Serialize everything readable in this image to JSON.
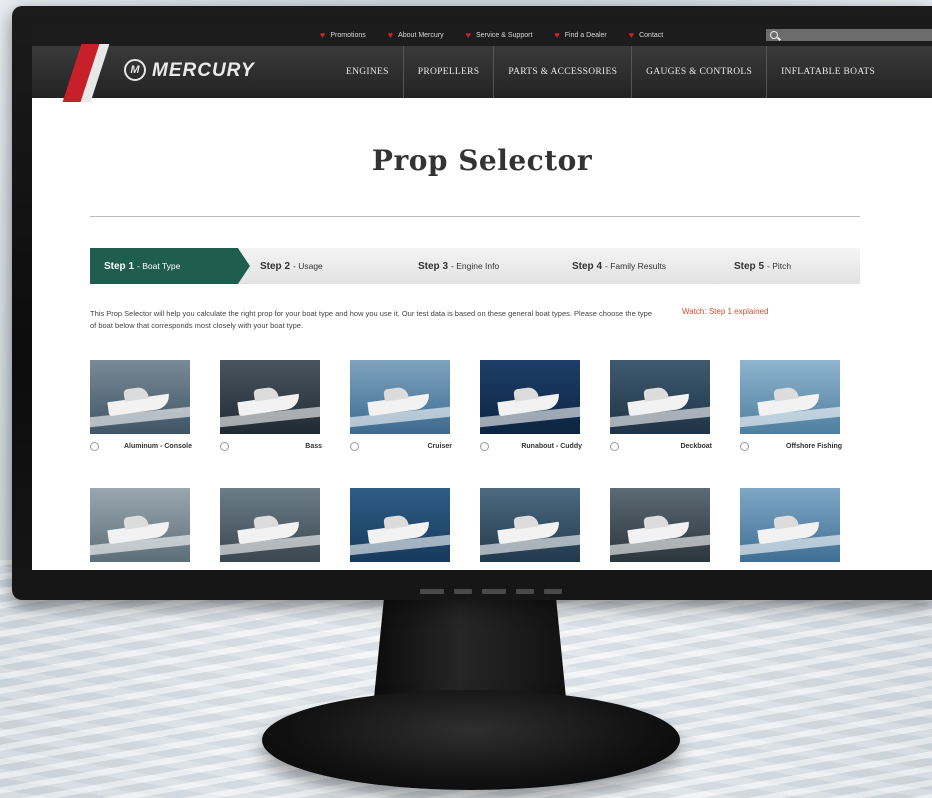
{
  "top_links": [
    {
      "label": "Promotions",
      "icon": "heart-icon"
    },
    {
      "label": "About Mercury",
      "icon": "heart-icon"
    },
    {
      "label": "Service & Support",
      "icon": "heart-icon"
    },
    {
      "label": "Find a Dealer",
      "icon": "heart-icon"
    },
    {
      "label": "Contact",
      "icon": "heart-icon"
    }
  ],
  "search": {
    "placeholder": ""
  },
  "brand": {
    "name": "MERCURY",
    "emblem": "M"
  },
  "nav": [
    "ENGINES",
    "PROPELLERS",
    "PARTS & ACCESSORIES",
    "GAUGES & CONTROLS",
    "INFLATABLE BOATS"
  ],
  "page_title": "Prop Selector",
  "steps": [
    {
      "num": "Step 1",
      "label": "- Boat Type",
      "active": true
    },
    {
      "num": "Step 2",
      "label": "- Usage",
      "active": false
    },
    {
      "num": "Step 3",
      "label": "- Engine Info",
      "active": false
    },
    {
      "num": "Step 4",
      "label": "- Family Results",
      "active": false
    },
    {
      "num": "Step 5",
      "label": "- Pitch",
      "active": false
    }
  ],
  "intro_text": "This Prop Selector will help you calculate the right prop for your boat type and how you use it. Our test data is based on these general boat types. Please choose the type of boat below that corresponds most closely with your boat type.",
  "watch_link": "Watch: Step 1 explained",
  "boats": [
    {
      "label": "Aluminum - Console",
      "colors": [
        "#7a8a96",
        "#3f5566"
      ]
    },
    {
      "label": "Bass",
      "colors": [
        "#4a5560",
        "#1f2a33"
      ]
    },
    {
      "label": "Cruiser",
      "colors": [
        "#7fa3bf",
        "#3c6a8f"
      ]
    },
    {
      "label": "Runabout - Cuddy",
      "colors": [
        "#1d3f6a",
        "#0c2440"
      ]
    },
    {
      "label": "Deckboat",
      "colors": [
        "#3f5a70",
        "#1f3446"
      ]
    },
    {
      "label": "Offshore Fishing",
      "colors": [
        "#8fb4cf",
        "#4f7f9f"
      ]
    },
    {
      "label": "",
      "colors": [
        "#9aa7ae",
        "#5d6e78"
      ]
    },
    {
      "label": "",
      "colors": [
        "#6c7d87",
        "#3a4650"
      ]
    },
    {
      "label": "",
      "colors": [
        "#2f5d86",
        "#173a5c"
      ]
    },
    {
      "label": "",
      "colors": [
        "#4d6a80",
        "#22394c"
      ]
    },
    {
      "label": "",
      "colors": [
        "#5d6b74",
        "#2b353c"
      ]
    },
    {
      "label": "",
      "colors": [
        "#7fa7c6",
        "#3f6f93"
      ]
    }
  ],
  "colors": {
    "accent": "#1f5d4e",
    "brand_red": "#c8202a",
    "link": "#d64a2e"
  }
}
